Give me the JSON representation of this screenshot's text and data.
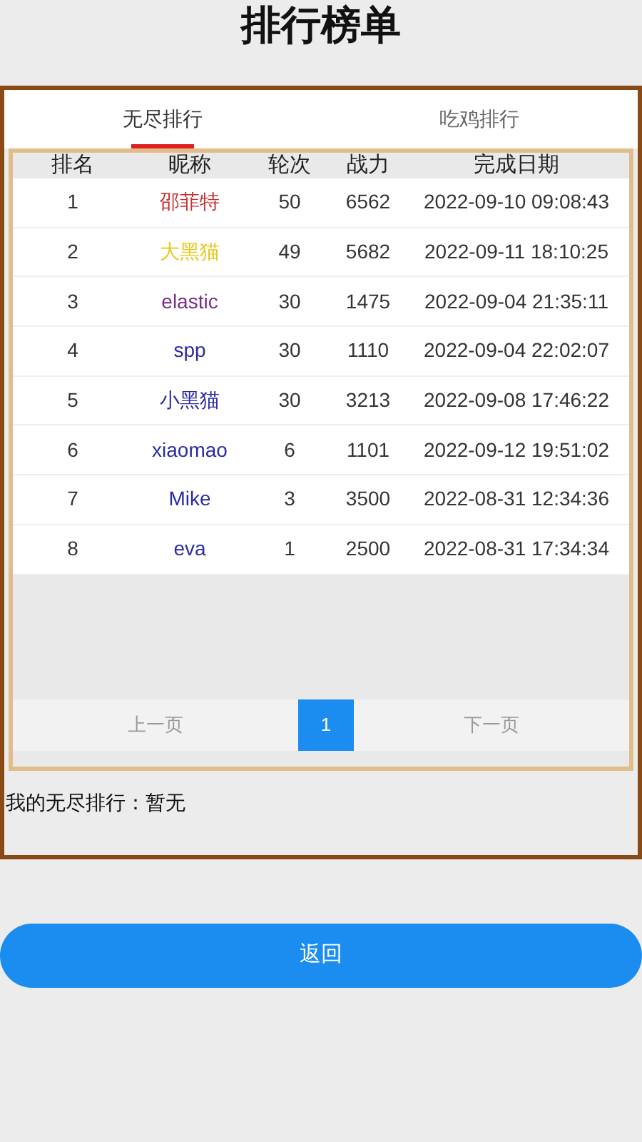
{
  "title": "排行榜单",
  "tabs": [
    {
      "label": "无尽排行",
      "selected": true
    },
    {
      "label": "吃鸡排行",
      "selected": false
    }
  ],
  "table": {
    "columns": [
      "排名",
      "昵称",
      "轮次",
      "战力",
      "完成日期"
    ],
    "rows": [
      {
        "rank": "1",
        "name": "邵菲特",
        "color": "#c62f2f",
        "rounds": "50",
        "power": "6562",
        "date": "2022-09-10 09:08:43"
      },
      {
        "rank": "2",
        "name": "大黑猫",
        "color": "#e8c71a",
        "rounds": "49",
        "power": "5682",
        "date": "2022-09-11 18:10:25"
      },
      {
        "rank": "3",
        "name": "elastic",
        "color": "#7a2c8a",
        "rounds": "30",
        "power": "1475",
        "date": "2022-09-04 21:35:11"
      },
      {
        "rank": "4",
        "name": "spp",
        "color": "#2b2ba3",
        "rounds": "30",
        "power": "1110",
        "date": "2022-09-04 22:02:07"
      },
      {
        "rank": "5",
        "name": "小黑猫",
        "color": "#2b2ba3",
        "rounds": "30",
        "power": "3213",
        "date": "2022-09-08 17:46:22"
      },
      {
        "rank": "6",
        "name": "xiaomao",
        "color": "#2b2ba3",
        "rounds": "6",
        "power": "1101",
        "date": "2022-09-12 19:51:02"
      },
      {
        "rank": "7",
        "name": "Mike",
        "color": "#2b2ba3",
        "rounds": "3",
        "power": "3500",
        "date": "2022-08-31 12:34:36"
      },
      {
        "rank": "8",
        "name": "eva",
        "color": "#2b2ba3",
        "rounds": "1",
        "power": "2500",
        "date": "2022-08-31 17:34:34"
      }
    ]
  },
  "pagination": {
    "prev": "上一页",
    "pages": [
      {
        "label": "1",
        "selected": true
      }
    ],
    "next": "下一页"
  },
  "my_rank": "我的无尽排行：暂无",
  "back_button": "返回"
}
